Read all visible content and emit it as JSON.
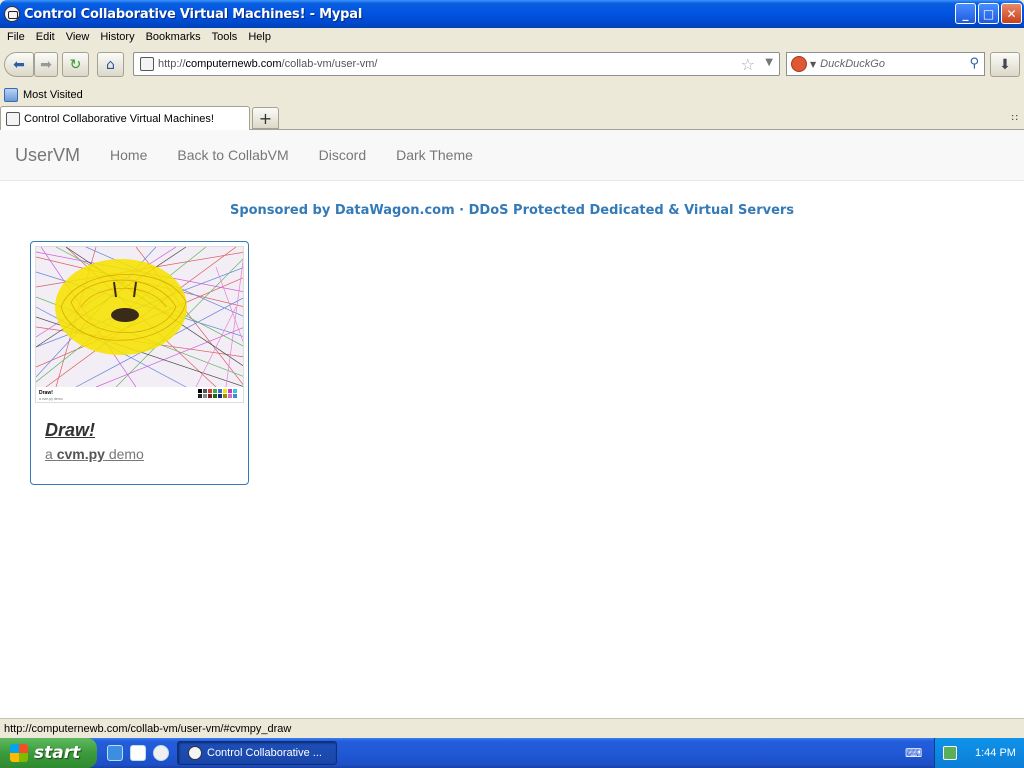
{
  "window": {
    "title": "Control Collaborative Virtual Machines! - Mypal",
    "buttons": {
      "minimize": "_",
      "maximize": "□",
      "close": "✕"
    }
  },
  "menu": [
    "File",
    "Edit",
    "View",
    "History",
    "Bookmarks",
    "Tools",
    "Help"
  ],
  "toolbar": {
    "url_prefix": "http://",
    "url_domain": "computernewb.com",
    "url_path": "/collab-vm/user-vm/",
    "search_placeholder": "DuckDuckGo"
  },
  "bookmarks": {
    "items": [
      "Most Visited"
    ]
  },
  "tabs": {
    "active_title": "Control Collaborative Virtual Machines!",
    "new_tab": "+"
  },
  "site": {
    "brand": "UserVM",
    "nav": [
      "Home",
      "Back to CollabVM",
      "Discord",
      "Dark Theme"
    ],
    "sponsor": "Sponsored by DataWagon.com · DDoS Protected Dedicated & Virtual Servers",
    "vm_card": {
      "title": "Draw!",
      "desc_prefix": "a ",
      "desc_bold": "cvm.py",
      "desc_suffix": " demo",
      "thumb_caption_title": "Draw!",
      "thumb_caption_sub": "a cvm.py demo"
    }
  },
  "statusbar": {
    "text": "http://computernewb.com/collab-vm/user-vm/#cvmpy_draw"
  },
  "taskbar": {
    "start_label": "start",
    "task_item": "Control Collaborative ...",
    "clock": "1:44 PM"
  },
  "colors": {
    "link": "#337ab7",
    "taskbar": "#245edb",
    "start": "#3c9a3c"
  }
}
